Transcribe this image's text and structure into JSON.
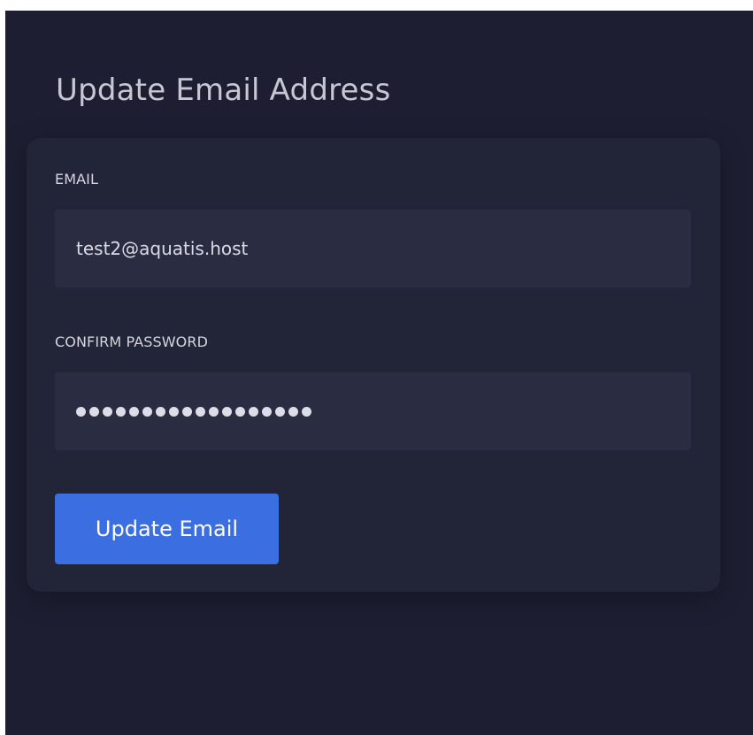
{
  "header": {
    "title": "Update Email Address"
  },
  "form": {
    "email": {
      "label": "EMAIL",
      "value": "test2@aquatis.host"
    },
    "password": {
      "label": "CONFIRM PASSWORD",
      "masked_length": 18
    },
    "submit_label": "Update Email"
  },
  "colors": {
    "background": "#1d1e31",
    "card": "#222438",
    "input": "#2a2d42",
    "accent": "#3b6ee0",
    "title_text": "#c6c7d2"
  }
}
